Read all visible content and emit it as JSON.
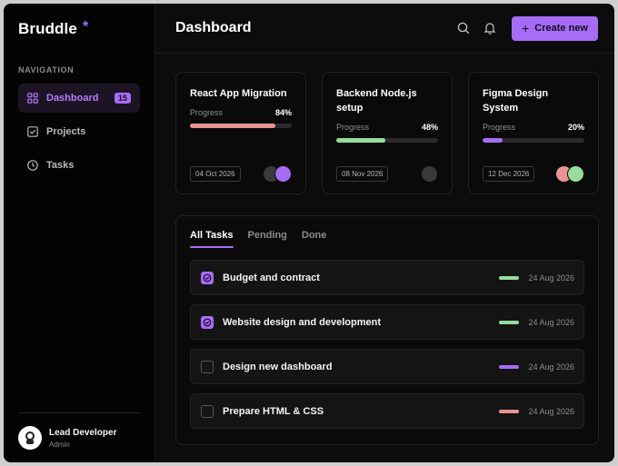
{
  "brand": {
    "name": "Bruddle",
    "star": "*"
  },
  "sidebar": {
    "heading": "NAVIGATION",
    "items": [
      {
        "label": "Dashboard",
        "icon": "grid-icon",
        "badge": "15",
        "active": true
      },
      {
        "label": "Projects",
        "icon": "checkbox-icon",
        "active": false
      },
      {
        "label": "Tasks",
        "icon": "clock-icon",
        "active": false
      }
    ],
    "user": {
      "name": "Lead Developer",
      "role": "Admin"
    }
  },
  "header": {
    "title": "Dashboard",
    "create_label": "Create new"
  },
  "projects": [
    {
      "title": "React App Migration",
      "progress_label": "Progress",
      "progress": 84,
      "progress_text": "84%",
      "bar_color": "#e99494",
      "date": "04 Oct 2026",
      "avatar_colors": [
        "#3a3a3a",
        "#a66cf5"
      ]
    },
    {
      "title": "Backend Node.js setup",
      "progress_label": "Progress",
      "progress": 48,
      "progress_text": "48%",
      "bar_color": "#97dc9d",
      "date": "08 Nov 2026",
      "avatar_colors": [
        "#3a3a3a"
      ]
    },
    {
      "title": "Figma Design System",
      "progress_label": "Progress",
      "progress": 20,
      "progress_text": "20%",
      "bar_color": "#a66cf5",
      "date": "12 Dec 2026",
      "avatar_colors": [
        "#e99494",
        "#97dc9d"
      ]
    }
  ],
  "tasks": {
    "tabs": [
      {
        "label": "All Tasks",
        "active": true
      },
      {
        "label": "Pending",
        "active": false
      },
      {
        "label": "Done",
        "active": false
      }
    ],
    "items": [
      {
        "title": "Budget and contract",
        "done": true,
        "bar_color": "#97dc9d",
        "date": "24 Aug 2026"
      },
      {
        "title": "Website design and development",
        "done": true,
        "bar_color": "#97dc9d",
        "date": "24 Aug 2026"
      },
      {
        "title": "Design new dashboard",
        "done": false,
        "bar_color": "#a66cf5",
        "date": "24 Aug 2026"
      },
      {
        "title": "Prepare HTML & CSS",
        "done": false,
        "bar_color": "#e99494",
        "date": "24 Aug 2026"
      }
    ]
  },
  "colors": {
    "accent": "#a66cf5",
    "green": "#97dc9d",
    "red": "#e99494"
  }
}
